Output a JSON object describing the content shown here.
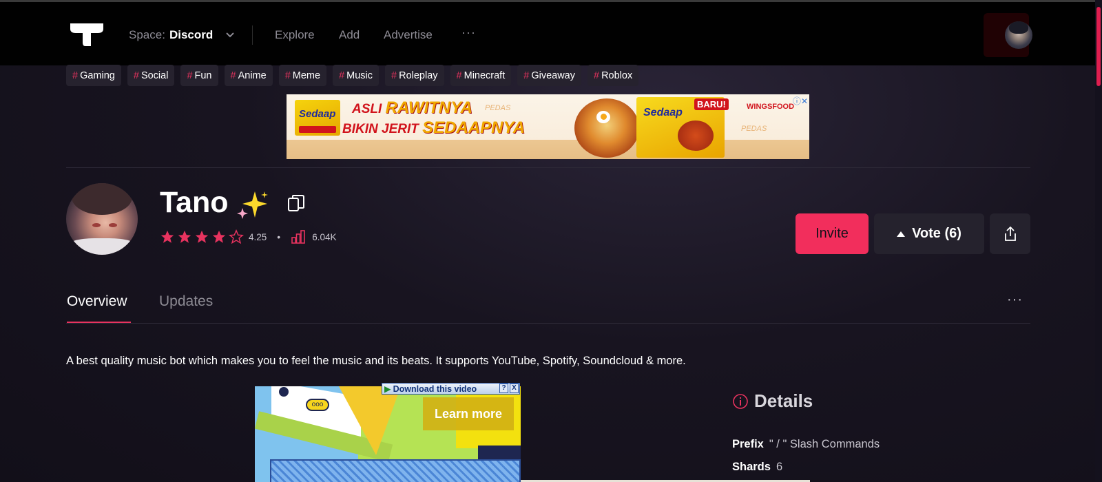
{
  "header": {
    "space_label": "Space:",
    "space_value": "Discord",
    "nav": [
      "Explore",
      "Add",
      "Advertise"
    ],
    "more": "···"
  },
  "tags": [
    {
      "hash": "#",
      "label": "Gaming"
    },
    {
      "hash": "#",
      "label": "Social"
    },
    {
      "hash": "#",
      "label": "Fun"
    },
    {
      "hash": "#",
      "label": "Anime"
    },
    {
      "hash": "#",
      "label": "Meme"
    },
    {
      "hash": "#",
      "label": "Music"
    },
    {
      "hash": "#",
      "label": "Roleplay"
    },
    {
      "hash": "#",
      "label": "Minecraft"
    },
    {
      "hash": "#",
      "label": "Giveaway"
    },
    {
      "hash": "#",
      "label": "Roblox"
    }
  ],
  "ad_banner": {
    "brand": "Sedaap",
    "line1_a": "ASLI ",
    "line1_b": "RAWITNYA",
    "line2_a": "BIKIN JERIT ",
    "line2_b": "SEDAAPNYA",
    "badge": "BARU!",
    "sponsor": "WINGSFOOD",
    "pedas": "PEDAS"
  },
  "bot": {
    "name": "Tano",
    "rating": "4.25",
    "rating_stars": 4.25,
    "separator": "•",
    "servers": "6.04K"
  },
  "actions": {
    "invite": "Invite",
    "vote": "Vote (6)"
  },
  "tabs": {
    "overview": "Overview",
    "updates": "Updates",
    "more": "···"
  },
  "description": "A best quality music bot which makes you to feel the music and its beats. It supports YouTube, Spotify, Soundcloud & more.",
  "video_ad": {
    "download": "Download this video",
    "help": "?",
    "close": "X",
    "learn_more": "Learn more",
    "bubble": "ooo"
  },
  "details": {
    "title": "Details",
    "prefix_label": "Prefix",
    "prefix_value": "\" / \" Slash Commands",
    "shards_label": "Shards",
    "shards_value": "6"
  },
  "colors": {
    "accent": "#f22e5c",
    "background": "#14111d",
    "topbar": "#010101",
    "tag_bg": "#26222e"
  },
  "icons": [
    "logo-icon",
    "chevron-down-icon",
    "avatar",
    "sparkles-icon",
    "copy-icon",
    "star-icon",
    "bar-chart-icon",
    "caret-up-icon",
    "share-icon",
    "info-icon"
  ]
}
